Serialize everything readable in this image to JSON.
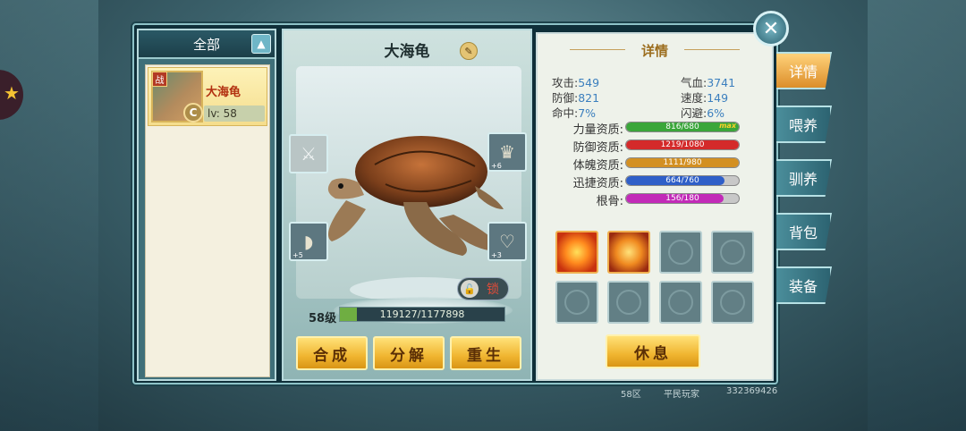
{
  "filter": {
    "label": "全部"
  },
  "pet_list": [
    {
      "name": "大海龟",
      "level": "lv: 58",
      "badge": "战",
      "grade": "C"
    }
  ],
  "pet": {
    "name": "大海龟",
    "lock_label": "锁",
    "level_label": "58级",
    "exp_text": "119127/1177898",
    "exp_fraction": 0.101
  },
  "equip_slots": [
    {
      "icon": "armor-icon",
      "glyph": "⚔",
      "num": ""
    },
    {
      "icon": "helmet-icon",
      "glyph": "♛",
      "num": "+6"
    },
    {
      "icon": "bracer-icon",
      "glyph": "◗",
      "num": "+5"
    },
    {
      "icon": "necklace-icon",
      "glyph": "♡",
      "num": "+3"
    }
  ],
  "actions": {
    "combine": "合成",
    "decompose": "分解",
    "rebirth": "重生"
  },
  "detail": {
    "title": "详情",
    "stats": [
      {
        "label": "攻击:",
        "value": "549"
      },
      {
        "label": "气血:",
        "value": "3741"
      },
      {
        "label": "防御:",
        "value": "821"
      },
      {
        "label": "速度:",
        "value": "149"
      },
      {
        "label": "命中:",
        "value": "7%"
      },
      {
        "label": "闪避:",
        "value": "6%"
      }
    ],
    "aptitudes": [
      {
        "label": "力量资质:",
        "text": "816/680",
        "fraction": 1.0,
        "color": "#3aa63a",
        "max": "max"
      },
      {
        "label": "防御资质:",
        "text": "1219/1080",
        "fraction": 1.0,
        "color": "#d42a2a",
        "max": ""
      },
      {
        "label": "体魄资质:",
        "text": "1111/980",
        "fraction": 1.0,
        "color": "#d39022",
        "max": ""
      },
      {
        "label": "迅捷资质:",
        "text": "664/760",
        "fraction": 0.874,
        "color": "#2f5fc8",
        "max": ""
      },
      {
        "label": "根骨:",
        "text": "156/180",
        "fraction": 0.867,
        "color": "#c22ab8",
        "max": ""
      }
    ],
    "rest_label": "休息"
  },
  "tabs": [
    "详情",
    "喂养",
    "驯养",
    "背包",
    "装备"
  ],
  "footer": {
    "server": "58区",
    "role": "平民玩家",
    "id": "332369426"
  }
}
